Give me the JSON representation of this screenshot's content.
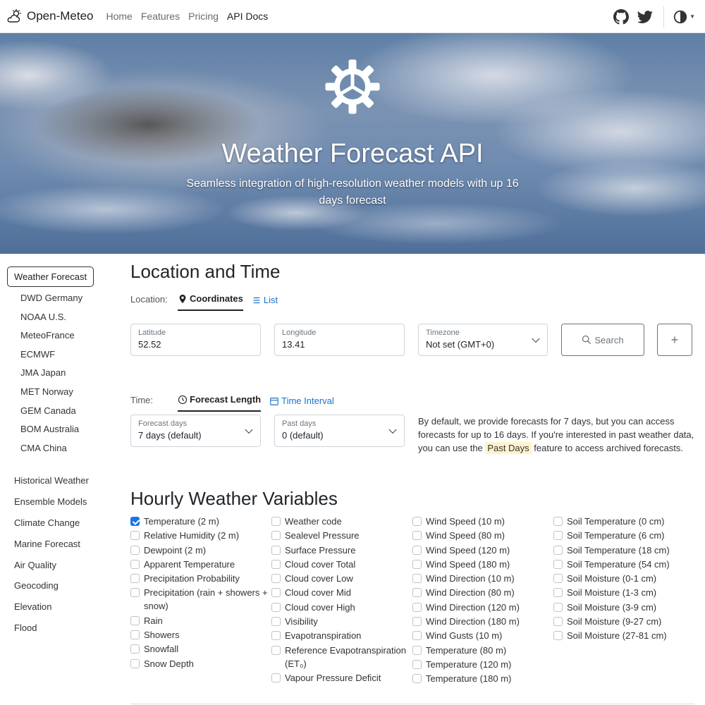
{
  "navbar": {
    "brand": "Open-Meteo",
    "links": [
      {
        "label": "Home",
        "active": false
      },
      {
        "label": "Features",
        "active": false
      },
      {
        "label": "Pricing",
        "active": false
      },
      {
        "label": "API Docs",
        "active": true
      }
    ],
    "icons": [
      "github-icon",
      "twitter-icon",
      "theme-toggle-icon"
    ]
  },
  "hero": {
    "title": "Weather Forecast API",
    "subtitle": "Seamless integration of high-resolution weather models with up 16 days forecast"
  },
  "sidebar": {
    "active": "Weather Forecast",
    "sub_items": [
      "DWD Germany",
      "NOAA U.S.",
      "MeteoFrance",
      "ECMWF",
      "JMA Japan",
      "MET Norway",
      "GEM Canada",
      "BOM Australia",
      "CMA China"
    ],
    "items": [
      "Historical Weather",
      "Ensemble Models",
      "Climate Change",
      "Marine Forecast",
      "Air Quality",
      "Geocoding",
      "Elevation",
      "Flood"
    ]
  },
  "location": {
    "title": "Location and Time",
    "label": "Location:",
    "tab_coordinates": "Coordinates",
    "tab_list": "List",
    "latitude_label": "Latitude",
    "latitude_value": "52.52",
    "longitude_label": "Longitude",
    "longitude_value": "13.41",
    "timezone_label": "Timezone",
    "timezone_value": "Not set (GMT+0)",
    "search_label": "Search",
    "add_label": "+"
  },
  "time": {
    "label": "Time:",
    "tab_forecast": "Forecast Length",
    "tab_interval": "Time Interval",
    "forecast_days_label": "Forecast days",
    "forecast_days_value": "7 days (default)",
    "past_days_label": "Past days",
    "past_days_value": "0 (default)",
    "help_before": "By default, we provide forecasts for 7 days, but you can access forecasts for up to 16 days. If you're interested in past weather data, you can use the",
    "help_mark": "Past Days",
    "help_after": "feature to access archived forecasts."
  },
  "hourly": {
    "title": "Hourly Weather Variables",
    "columns": [
      [
        {
          "label": "Temperature (2 m)",
          "checked": true
        },
        {
          "label": "Relative Humidity (2 m)",
          "checked": false
        },
        {
          "label": "Dewpoint (2 m)",
          "checked": false
        },
        {
          "label": "Apparent Temperature",
          "checked": false
        },
        {
          "label": "Precipitation Probability",
          "checked": false
        },
        {
          "label": "Precipitation (rain + showers + snow)",
          "checked": false
        },
        {
          "label": "Rain",
          "checked": false
        },
        {
          "label": "Showers",
          "checked": false
        },
        {
          "label": "Snowfall",
          "checked": false
        },
        {
          "label": "Snow Depth",
          "checked": false
        }
      ],
      [
        {
          "label": "Weather code",
          "checked": false
        },
        {
          "label": "Sealevel Pressure",
          "checked": false
        },
        {
          "label": "Surface Pressure",
          "checked": false
        },
        {
          "label": "Cloud cover Total",
          "checked": false
        },
        {
          "label": "Cloud cover Low",
          "checked": false
        },
        {
          "label": "Cloud cover Mid",
          "checked": false
        },
        {
          "label": "Cloud cover High",
          "checked": false
        },
        {
          "label": "Visibility",
          "checked": false
        },
        {
          "label": "Evapotranspiration",
          "checked": false
        },
        {
          "label": "Reference Evapotranspiration (ET₀)",
          "checked": false
        },
        {
          "label": "Vapour Pressure Deficit",
          "checked": false
        }
      ],
      [
        {
          "label": "Wind Speed (10 m)",
          "checked": false
        },
        {
          "label": "Wind Speed (80 m)",
          "checked": false
        },
        {
          "label": "Wind Speed (120 m)",
          "checked": false
        },
        {
          "label": "Wind Speed (180 m)",
          "checked": false
        },
        {
          "label": "Wind Direction (10 m)",
          "checked": false
        },
        {
          "label": "Wind Direction (80 m)",
          "checked": false
        },
        {
          "label": "Wind Direction (120 m)",
          "checked": false
        },
        {
          "label": "Wind Direction (180 m)",
          "checked": false
        },
        {
          "label": "Wind Gusts (10 m)",
          "checked": false
        },
        {
          "label": "Temperature (80 m)",
          "checked": false
        },
        {
          "label": "Temperature (120 m)",
          "checked": false
        },
        {
          "label": "Temperature (180 m)",
          "checked": false
        }
      ],
      [
        {
          "label": "Soil Temperature (0 cm)",
          "checked": false
        },
        {
          "label": "Soil Temperature (6 cm)",
          "checked": false
        },
        {
          "label": "Soil Temperature (18 cm)",
          "checked": false
        },
        {
          "label": "Soil Temperature (54 cm)",
          "checked": false
        },
        {
          "label": "Soil Moisture (0-1 cm)",
          "checked": false
        },
        {
          "label": "Soil Moisture (1-3 cm)",
          "checked": false
        },
        {
          "label": "Soil Moisture (3-9 cm)",
          "checked": false
        },
        {
          "label": "Soil Moisture (9-27 cm)",
          "checked": false
        },
        {
          "label": "Soil Moisture (27-81 cm)",
          "checked": false
        }
      ]
    ]
  },
  "colors": {
    "link": "#1a73c8",
    "checkbox_checked": "#1a73e8",
    "highlight": "#fff3cd"
  }
}
